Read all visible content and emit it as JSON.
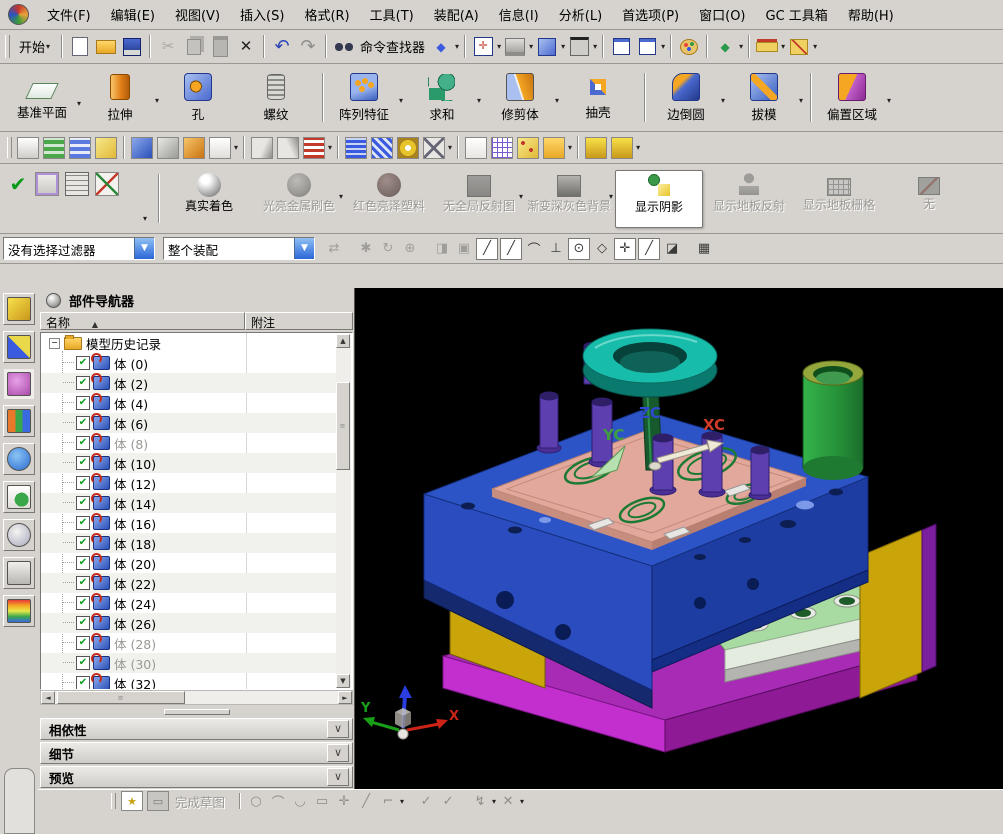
{
  "icons": {
    "caret": "▾",
    "dropdown": "▼",
    "sort_asc": "▲",
    "chevron": "∨",
    "collapse": "−",
    "check": "✔",
    "cut": "✂",
    "delete": "✕",
    "undo": "↶",
    "redo": "↷",
    "up": "▲",
    "down": "▼",
    "left": "◄",
    "right": "►",
    "slash": "╱",
    "plus": "✛",
    "circle_center": "⊙",
    "quadrant": "◇",
    "arc": "⌒",
    "perp": "⊥",
    "face": "◪",
    "grid": "▦",
    "swap": "⇄",
    "gear": "✱",
    "rotate": "↻",
    "target": "⊕",
    "eraser": "◨",
    "box": "▣",
    "star": "★",
    "fit": "✛",
    "diamond": "◆",
    "sketch_circle": "○",
    "sketch_arc": "⌒",
    "sketch_fillet": "◡",
    "sketch_rect": "▭",
    "sketch_point": "✛",
    "sketch_line": "╱",
    "sketch_profile": "⌐",
    "sketch_check": "✓",
    "sketch_flash": "↯",
    "sketch_trim": "✕"
  },
  "menu_bar": {
    "items": [
      "文件(F)",
      "编辑(E)",
      "视图(V)",
      "插入(S)",
      "格式(R)",
      "工具(T)",
      "装配(A)",
      "信息(I)",
      "分析(L)",
      "首选项(P)",
      "窗口(O)",
      "GC 工具箱",
      "帮助(H)"
    ]
  },
  "standard_toolbar": {
    "start": "开始",
    "command_finder": "命令查找器"
  },
  "feature_toolbar": {
    "buttons": [
      {
        "label": "基准平面",
        "icon": "datum-plane",
        "dropdown": true
      },
      {
        "label": "拉伸",
        "icon": "extrude",
        "dropdown": true
      },
      {
        "label": "孔",
        "icon": "hole",
        "dropdown": false
      },
      {
        "label": "螺纹",
        "icon": "thread",
        "dropdown": false,
        "group_end": true
      },
      {
        "label": "阵列特征",
        "icon": "pattern-feature",
        "dropdown": true
      },
      {
        "label": "求和",
        "icon": "unite",
        "dropdown": true
      },
      {
        "label": "修剪体",
        "icon": "trim-body",
        "dropdown": true
      },
      {
        "label": "抽壳",
        "icon": "shell",
        "dropdown": false,
        "group_end": true
      },
      {
        "label": "边倒圆",
        "icon": "edge-blend",
        "dropdown": true
      },
      {
        "label": "拔模",
        "icon": "draft",
        "dropdown": true,
        "group_end": true
      },
      {
        "label": "偏置区域",
        "icon": "offset-region",
        "dropdown": true
      }
    ]
  },
  "utility_toolbar": {
    "icons": [
      {
        "name": "display-mode"
      },
      {
        "name": "layer-stack"
      },
      {
        "name": "layer-settings"
      },
      {
        "name": "note-tag",
        "sep_after": true
      },
      {
        "name": "examine-body"
      },
      {
        "name": "examine-feature"
      },
      {
        "name": "examine-solid"
      },
      {
        "name": "text-edit",
        "caret": true,
        "sep_after": true
      },
      {
        "name": "chamfer-a"
      },
      {
        "name": "chamfer-b"
      },
      {
        "name": "reorder-list",
        "caret": true,
        "sep_after": true
      },
      {
        "name": "coil"
      },
      {
        "name": "spring"
      },
      {
        "name": "washer"
      },
      {
        "name": "scissors",
        "caret": true,
        "sep_after": true
      },
      {
        "name": "triangle-mesh"
      },
      {
        "name": "table-annotation"
      },
      {
        "name": "point-set"
      },
      {
        "name": "folder-group",
        "caret": true,
        "sep_after": true
      },
      {
        "name": "lock-single"
      },
      {
        "name": "lock-group",
        "caret": true
      }
    ]
  },
  "visualization_toolbar": {
    "render_buttons": [
      {
        "label": "真实着色",
        "icon": "shiny-sphere",
        "state": "normal"
      },
      {
        "label": "光亮金属刷色",
        "icon": "metal-sphere",
        "state": "disabled",
        "dropdown": true
      },
      {
        "label": "红色亮泽塑料",
        "icon": "red-sphere",
        "state": "disabled"
      },
      {
        "label": "无全局反射图",
        "icon": "dark-square",
        "state": "disabled",
        "dropdown": true
      },
      {
        "label": "渐变深灰色背景",
        "icon": "gradient-square",
        "state": "disabled",
        "dropdown": true
      },
      {
        "label": "显示阴影",
        "icon": "shadow-lamp",
        "state": "active"
      },
      {
        "label": "显示地板反射",
        "icon": "floor-person",
        "state": "disabled"
      },
      {
        "label": "显示地板栅格",
        "icon": "floor-grid",
        "state": "disabled"
      },
      {
        "label": "无",
        "icon": "none-slash",
        "state": "disabled"
      }
    ]
  },
  "selection_bar": {
    "filter": "没有选择过滤器",
    "scope": "整个装配",
    "tool_icons": [
      {
        "name": "interpart-link",
        "glyph": "swap",
        "sep_after": true
      },
      {
        "name": "gear-tool",
        "glyph": "gear"
      },
      {
        "name": "rotate-tool",
        "glyph": "rotate"
      },
      {
        "name": "hook-tool",
        "glyph": "target",
        "sep_after": true
      },
      {
        "name": "eraser-tool",
        "glyph": "eraser"
      },
      {
        "name": "box-select-tool",
        "glyph": "box"
      }
    ],
    "snap_icons": [
      {
        "name": "snap-endpoint",
        "glyph": "slash",
        "boxed": true
      },
      {
        "name": "snap-midpoint",
        "glyph": "slash",
        "boxed": true
      },
      {
        "name": "snap-curve",
        "glyph": "arc",
        "boxed": false
      },
      {
        "name": "snap-intersection",
        "glyph": "perp",
        "boxed": false
      },
      {
        "name": "snap-center",
        "glyph": "circle_center",
        "boxed": true
      },
      {
        "name": "snap-quadrant",
        "glyph": "quadrant",
        "boxed": false
      },
      {
        "name": "snap-point",
        "glyph": "plus",
        "boxed": true
      },
      {
        "name": "snap-angle",
        "glyph": "slash",
        "boxed": true
      },
      {
        "name": "snap-face",
        "glyph": "face",
        "boxed": false
      }
    ],
    "grid_icon": "grid"
  },
  "resource_bar": {
    "items": [
      "assembly-navigator",
      "constraint-navigator",
      "part-navigator",
      "reuse-library",
      "hd3d-tools",
      "web-browser",
      "history",
      "process-studio",
      "materials"
    ],
    "active": "part-navigator"
  },
  "part_navigator": {
    "title": "部件导航器",
    "col_name": "名称",
    "col_note": "附注",
    "root_label": "模型历史记录",
    "items": [
      {
        "label": "体 (0)"
      },
      {
        "label": "体 (2)"
      },
      {
        "label": "体 (4)"
      },
      {
        "label": "体 (6)"
      },
      {
        "label": "体 (8)",
        "disabled": true
      },
      {
        "label": "体 (10)"
      },
      {
        "label": "体 (12)"
      },
      {
        "label": "体 (14)"
      },
      {
        "label": "体 (16)"
      },
      {
        "label": "体 (18)"
      },
      {
        "label": "体 (20)"
      },
      {
        "label": "体 (22)"
      },
      {
        "label": "体 (24)"
      },
      {
        "label": "体 (26)"
      },
      {
        "label": "体 (28)",
        "disabled": true
      },
      {
        "label": "体 (30)",
        "disabled": true
      },
      {
        "label": "体 (32)"
      }
    ]
  },
  "accordion_panels": [
    {
      "label": "相依性"
    },
    {
      "label": "细节"
    },
    {
      "label": "预览"
    }
  ],
  "viewport": {
    "wcs": {
      "zc": "ZC",
      "xc": "XC",
      "yc": "YC"
    },
    "triad": {
      "x": "X",
      "y": "Y"
    }
  },
  "sketch_toolbar": {
    "finish_sketch": "完成草图",
    "icons": [
      "sketch_circle",
      "sketch_arc",
      "sketch_fillet",
      "sketch_rect",
      "sketch_point",
      "sketch_line",
      "sketch_profile",
      "sketch_check",
      "sketch_check",
      "sketch_flash",
      "sketch_trim"
    ]
  }
}
